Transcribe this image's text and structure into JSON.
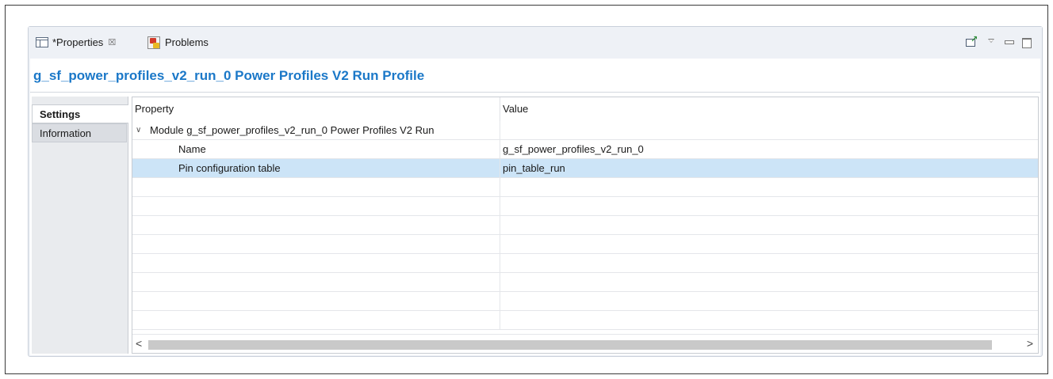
{
  "tabs": {
    "properties_label": "*Properties",
    "problems_label": "Problems",
    "close_glyph": "☒"
  },
  "toolbar": {
    "icons": [
      "pin-editor-icon",
      "view-menu-icon",
      "minimize-icon",
      "maximize-icon"
    ]
  },
  "page": {
    "title": "g_sf_power_profiles_v2_run_0 Power Profiles V2 Run Profile"
  },
  "sidebar": {
    "items": [
      {
        "label": "Settings",
        "active": true
      },
      {
        "label": "Information",
        "active": false
      }
    ]
  },
  "grid": {
    "headers": {
      "property": "Property",
      "value": "Value"
    },
    "rows": [
      {
        "property": "Module g_sf_power_profiles_v2_run_0 Power Profiles V2 Run",
        "value": "",
        "level": 0,
        "expanded": true
      },
      {
        "property": "Name",
        "value": "g_sf_power_profiles_v2_run_0",
        "level": 1
      },
      {
        "property": "Pin configuration table",
        "value": "pin_table_run",
        "level": 1,
        "selected": true
      }
    ],
    "empty_rows": 8
  },
  "scrollbar": {
    "left_arrow": "<",
    "right_arrow": ">"
  },
  "colors": {
    "title": "#1b78c8",
    "selection": "#cce4f7",
    "panel_bg": "#eef1f6"
  }
}
